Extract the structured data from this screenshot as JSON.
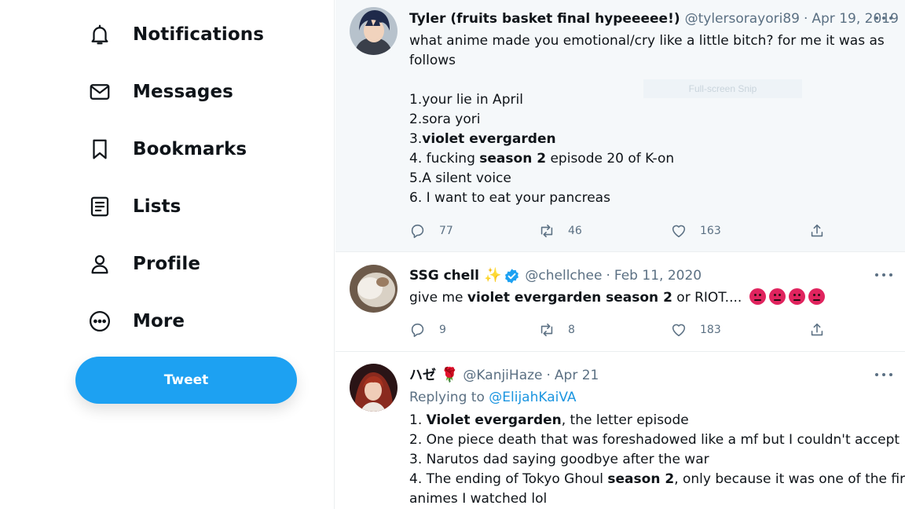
{
  "sidebar": {
    "items": [
      {
        "label": "Notifications",
        "icon": "bell-icon"
      },
      {
        "label": "Messages",
        "icon": "envelope-icon"
      },
      {
        "label": "Bookmarks",
        "icon": "bookmark-icon"
      },
      {
        "label": "Lists",
        "icon": "list-icon"
      },
      {
        "label": "Profile",
        "icon": "person-icon"
      },
      {
        "label": "More",
        "icon": "more-circle-icon"
      }
    ],
    "tweet_button": "Tweet"
  },
  "colors": {
    "accent": "#1da1f2",
    "link": "#1b95e0",
    "muted": "#5b7083",
    "text": "#0f1419"
  },
  "overlay": {
    "ghost_label": "Full-screen Snip"
  },
  "tweets": [
    {
      "name": "Tyler (fruits basket final hypeeeee!)",
      "handle": "@tylersorayori89",
      "date": "Apr 19, 2019",
      "lines": {
        "l1": "what anime made you emotional/cry like a little bitch? for me it was as",
        "l2": "follows",
        "l3": "1.your lie in April",
        "l4": "2.sora yori",
        "l5a": "3.",
        "l5b": "violet evergarden",
        "l6a": "4. fucking ",
        "l6b": "season 2",
        "l6c": " episode 20 of K-on",
        "l7": "5.A silent voice",
        "l8": "6. I want to eat your pancreas"
      },
      "replies": "77",
      "retweets": "46",
      "likes": "163"
    },
    {
      "name": "SSG chell",
      "name_emoji": "✨",
      "handle": "@chellchee",
      "date": "Feb 11, 2020",
      "lines": {
        "l1a": "give me ",
        "l1b": "violet evergarden season 2",
        "l1c": " or RIOT...."
      },
      "replies": "9",
      "retweets": "8",
      "likes": "183"
    },
    {
      "name": "ハゼ",
      "name_emoji": "🌹",
      "handle": "@KanjiHaze",
      "date": "Apr 21",
      "replying_label": "Replying to ",
      "replying_handle": "@ElijahKaiVA",
      "lines": {
        "l1a": "1. ",
        "l1b": "Violet evergarden",
        "l1c": ", the letter episode",
        "l2": "2. One piece death that was foreshadowed like a mf but I couldn't accept",
        "l3": "3. Narutos dad saying goodbye after the war",
        "l4a": "4. The ending of Tokyo Ghoul ",
        "l4b": "season 2",
        "l4c": ", only because it was one of the first",
        "l5": "animes I watched lol"
      }
    }
  ],
  "separator": "·"
}
